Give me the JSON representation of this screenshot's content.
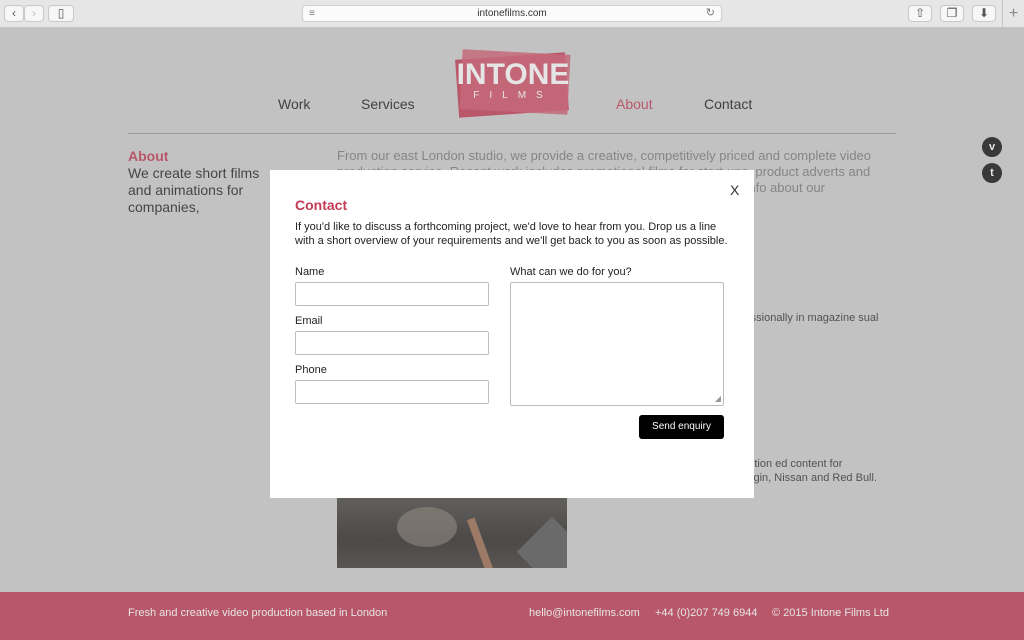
{
  "browser": {
    "url": "intonefilms.com",
    "back_icon": "chevron-left-icon",
    "forward_icon": "chevron-right-icon",
    "sidebar_icon": "sidebar-icon",
    "share_icon": "share-icon",
    "tabs_icon": "tabs-icon",
    "download_icon": "download-icon",
    "reader_icon": "reader-icon",
    "reload_icon": "reload-icon",
    "new_tab_icon": "plus-icon"
  },
  "logo": {
    "main": "INTONE",
    "sub": "FILMS"
  },
  "nav": {
    "work": "Work",
    "services": "Services",
    "about": "About",
    "contact": "Contact"
  },
  "about": {
    "heading": "About",
    "text": "We create short films and animations for companies, organisations and artists.",
    "intro": "From our east London studio, we provide a creative, competitively priced and complete video production service. Recent work includes promotional films for start-ups, product adverts and coverage of live events. We tell stories with clarity, and bringing further info about our"
  },
  "bio": {
    "para1": "rs as both a content using on video ssionally in magazine sual performance.",
    "para2": "duction at UCA before based production ed content for companies such as the BBC, BT, Virgin, Nissan and Red Bull."
  },
  "social": {
    "vimeo_icon": "vimeo-icon",
    "twitter_icon": "twitter-icon"
  },
  "footer": {
    "tagline": "Fresh and creative video production based in London",
    "email": "hello@intonefilms.com",
    "phone": "+44 (0)207 749 6944",
    "copyright": "© 2015 Intone Films Ltd"
  },
  "modal": {
    "close": "X",
    "title": "Contact",
    "description": "If you'd like to discuss a forthcoming project, we'd love to hear from you. Drop us a line with a short overview of your requirements and we'll get back to you as soon as possible.",
    "name_label": "Name",
    "email_label": "Email",
    "phone_label": "Phone",
    "message_label": "What can we do for you?",
    "name_value": "",
    "email_value": "",
    "phone_value": "",
    "message_value": "",
    "submit": "Send enquiry"
  },
  "colors": {
    "brand": "#c33b55",
    "footer_bg": "#c33b55",
    "page_bg": "#cfcfcf"
  }
}
